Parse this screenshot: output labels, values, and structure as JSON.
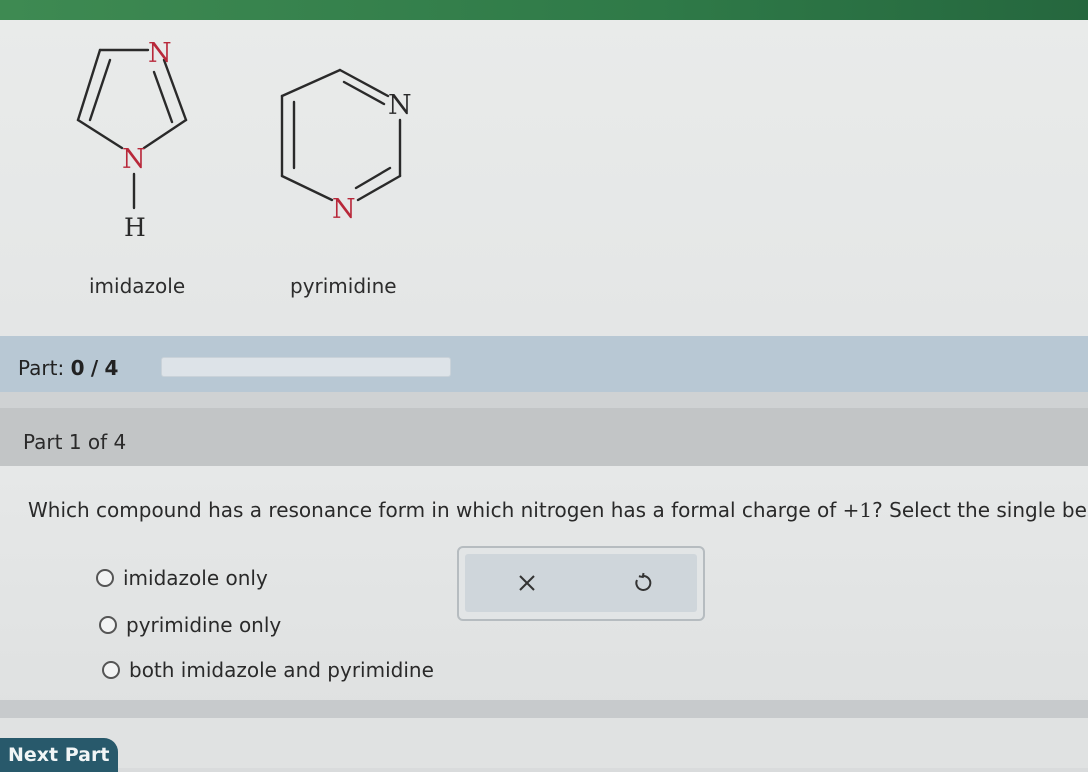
{
  "structures": {
    "imidazole": {
      "name": "imidazole",
      "atoms": {
        "n_top": "N",
        "n_bottom": "N",
        "h": "H"
      }
    },
    "pyrimidine": {
      "name": "pyrimidine",
      "atoms": {
        "n_right": "N",
        "n_bottom": "N"
      }
    }
  },
  "progress": {
    "label": "Part:",
    "current": "0",
    "separator": "/",
    "total": "4",
    "fraction": 0.0
  },
  "part_header": "Part 1 of 4",
  "question": {
    "before": "Which compound has a resonance form in which nitrogen has a formal charge of",
    "math": "+1",
    "after": "? Select the single best a"
  },
  "options": [
    {
      "label": "imidazole only",
      "selected": false
    },
    {
      "label": "pyrimidine only",
      "selected": false
    },
    {
      "label": "both imidazole and pyrimidine",
      "selected": false
    }
  ],
  "tools": {
    "clear_icon": "close-x-icon",
    "undo_icon": "undo-icon"
  },
  "footer": {
    "next_part_label": "Next Part"
  },
  "colors": {
    "accent_green": "#2f7a48",
    "progress_bar": "#b8c8d4",
    "next_button": "#28596b"
  }
}
